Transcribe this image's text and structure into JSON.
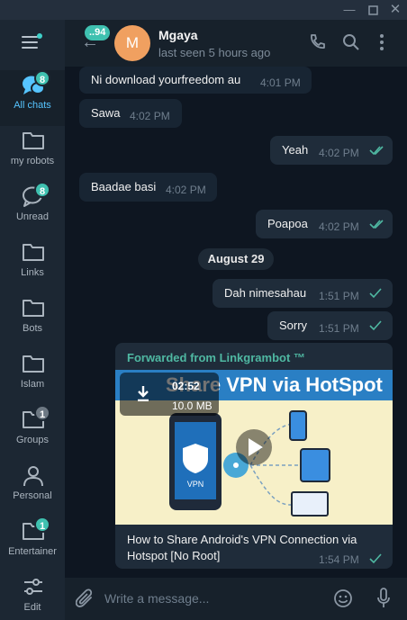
{
  "sidebar": {
    "folders": [
      {
        "label": "All chats",
        "badge": "8",
        "icon": "chats-icon",
        "active": true
      },
      {
        "label": "my robots",
        "badge": "",
        "icon": "folder-icon"
      },
      {
        "label": "Unread",
        "badge": "8",
        "icon": "chat-bubble-icon"
      },
      {
        "label": "Links",
        "badge": "",
        "icon": "folder-icon"
      },
      {
        "label": "Bots",
        "badge": "",
        "icon": "folder-icon"
      },
      {
        "label": "Islam",
        "badge": "",
        "icon": "folder-icon"
      },
      {
        "label": "Groups",
        "badge": "1",
        "icon": "folder-icon"
      },
      {
        "label": "Personal",
        "badge": "",
        "icon": "person-icon"
      },
      {
        "label": "Entertainer",
        "badge": "1",
        "icon": "folder-icon"
      },
      {
        "label": "Edit",
        "badge": "",
        "icon": "sliders-icon"
      }
    ]
  },
  "header": {
    "back_badge": "..94",
    "avatar_letter": "M",
    "name": "Mgaya",
    "status": "last seen 5 hours ago"
  },
  "messages": [
    {
      "text": "Ni download yourfreedom au",
      "time": "4:01 PM",
      "direction": "in"
    },
    {
      "text": "Sawa",
      "time": "4:02 PM",
      "direction": "in"
    },
    {
      "text": "Yeah",
      "time": "4:02 PM",
      "direction": "out",
      "status": "read"
    },
    {
      "text": "Baadae basi",
      "time": "4:02 PM",
      "direction": "in"
    },
    {
      "text": "Poapoa",
      "time": "4:02 PM",
      "direction": "out",
      "status": "read"
    },
    {
      "text": "Dah nimesahau",
      "time": "1:51 PM",
      "direction": "out",
      "status": "sent"
    },
    {
      "text": "Sorry",
      "time": "1:51 PM",
      "direction": "out",
      "status": "sent"
    }
  ],
  "date_separator": "August 29",
  "media_message": {
    "forwarded_from": "Forwarded from Linkgrambot ™",
    "video_title": "Share VPN via HotSpot",
    "duration": "02:52",
    "size": "10.0 MB",
    "vpn_label": "VPN",
    "caption": "How to Share Android's VPN Connection via Hotspot [No Root]",
    "time": "1:54 PM",
    "status": "sent"
  },
  "composer": {
    "placeholder": "Write a message..."
  },
  "colors": {
    "accent": "#56c4ff",
    "badge": "#3fc1b0",
    "check": "#4fb8a2",
    "avatar": "#f0a060"
  }
}
